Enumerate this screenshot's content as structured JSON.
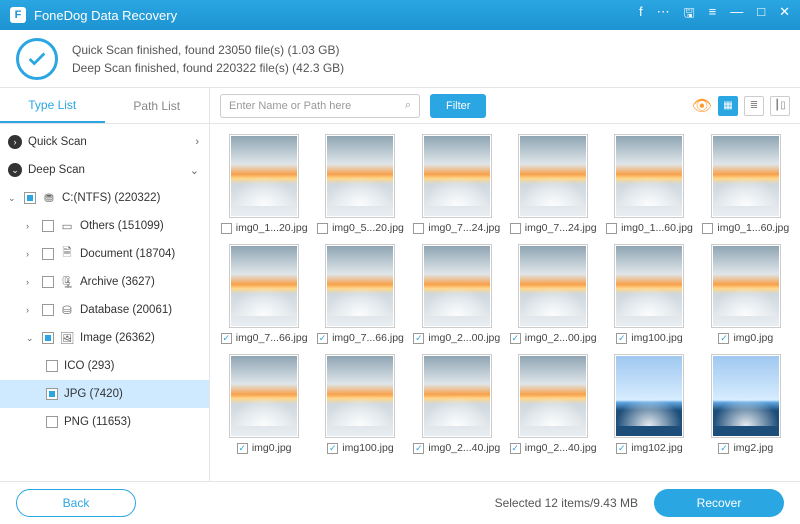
{
  "app": {
    "title": "FoneDog Data Recovery"
  },
  "status": {
    "line1": "Quick Scan finished, found 23050 file(s) (1.03 GB)",
    "line2": "Deep Scan finished, found 220322 file(s) (42.3 GB)"
  },
  "tabs": {
    "type_list": "Type List",
    "path_list": "Path List"
  },
  "tree": {
    "quick_scan": "Quick Scan",
    "deep_scan": "Deep Scan",
    "drive": "C:(NTFS) (220322)",
    "others": "Others (151099)",
    "document": "Document (18704)",
    "archive": "Archive (3627)",
    "database": "Database (20061)",
    "image": "Image (26362)",
    "ico": "ICO (293)",
    "jpg": "JPG (7420)",
    "png": "PNG (11653)"
  },
  "toolbar": {
    "search_placeholder": "Enter Name or Path here",
    "filter": "Filter"
  },
  "files": [
    {
      "name": "img0_1...20.jpg",
      "checked": false,
      "thumb": "sky"
    },
    {
      "name": "img0_5...20.jpg",
      "checked": false,
      "thumb": "sky"
    },
    {
      "name": "img0_7...24.jpg",
      "checked": false,
      "thumb": "sky"
    },
    {
      "name": "img0_7...24.jpg",
      "checked": false,
      "thumb": "sky"
    },
    {
      "name": "img0_1...60.jpg",
      "checked": false,
      "thumb": "sky"
    },
    {
      "name": "img0_1...60.jpg",
      "checked": false,
      "thumb": "sky"
    },
    {
      "name": "img0_7...66.jpg",
      "checked": true,
      "thumb": "sky"
    },
    {
      "name": "img0_7...66.jpg",
      "checked": true,
      "thumb": "sky"
    },
    {
      "name": "img0_2...00.jpg",
      "checked": true,
      "thumb": "sky"
    },
    {
      "name": "img0_2...00.jpg",
      "checked": true,
      "thumb": "sky"
    },
    {
      "name": "img100.jpg",
      "checked": true,
      "thumb": "sky"
    },
    {
      "name": "img0.jpg",
      "checked": true,
      "thumb": "sky"
    },
    {
      "name": "img0.jpg",
      "checked": true,
      "thumb": "sky"
    },
    {
      "name": "img100.jpg",
      "checked": true,
      "thumb": "sky"
    },
    {
      "name": "img0_2...40.jpg",
      "checked": true,
      "thumb": "sky"
    },
    {
      "name": "img0_2...40.jpg",
      "checked": true,
      "thumb": "sky"
    },
    {
      "name": "img102.jpg",
      "checked": true,
      "thumb": "isl"
    },
    {
      "name": "img2.jpg",
      "checked": true,
      "thumb": "isl"
    }
  ],
  "footer": {
    "back": "Back",
    "selected": "Selected 12 items/9.43 MB",
    "recover": "Recover"
  }
}
